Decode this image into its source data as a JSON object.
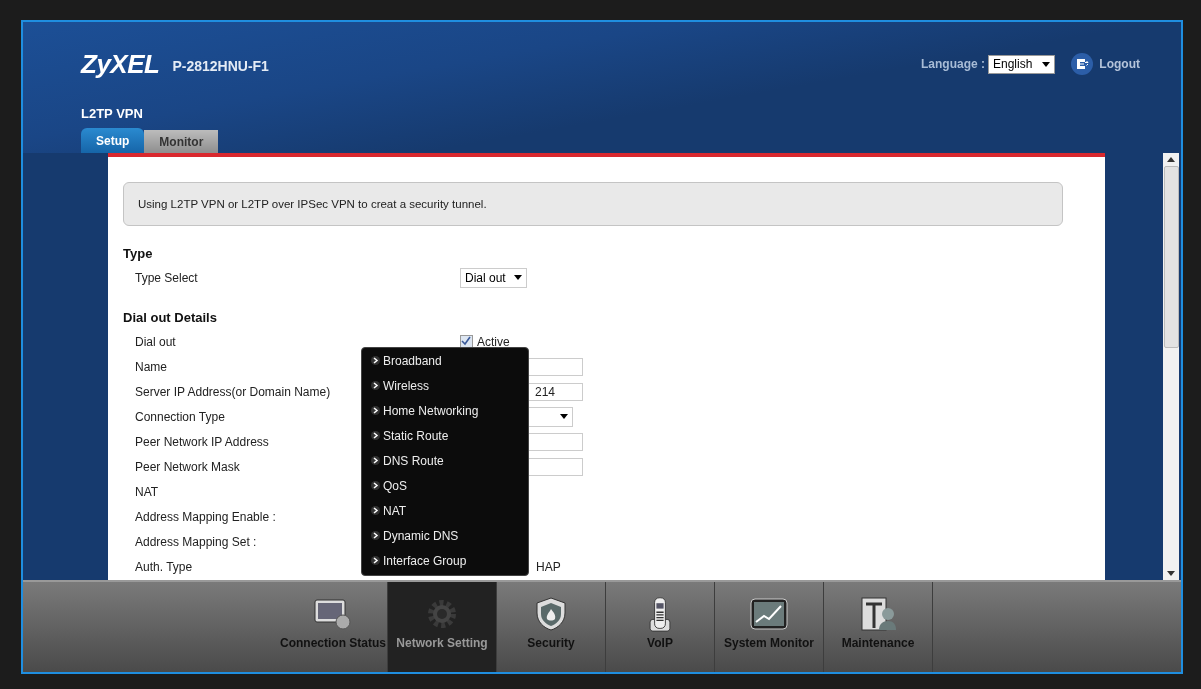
{
  "header": {
    "brand": "ZyXEL",
    "model": "P-2812HNU-F1",
    "language_label": "Language :",
    "language": "English",
    "logout": "Logout"
  },
  "page_title": "L2TP VPN",
  "tabs": [
    {
      "label": "Setup",
      "selected": true
    },
    {
      "label": "Monitor",
      "selected": false
    }
  ],
  "info": "Using L2TP VPN or L2TP over IPSec VPN to creat a security tunnel.",
  "sections": [
    {
      "title": "Type",
      "rows": [
        {
          "label": "Type Select",
          "kind": "select",
          "value": "Dial out"
        }
      ]
    },
    {
      "title": "Dial out Details",
      "rows": [
        {
          "label": "Dial out",
          "kind": "checkbox",
          "checked": true,
          "text": "Active"
        },
        {
          "label": "Name",
          "kind": "field"
        },
        {
          "label": "Server IP Address(or Domain Name)",
          "kind": "field",
          "value": "214"
        },
        {
          "label": "Connection Type",
          "kind": "select"
        },
        {
          "label": "Peer Network IP Address",
          "kind": "field"
        },
        {
          "label": "Peer Network Mask",
          "kind": "field"
        },
        {
          "label": "NAT",
          "kind": "none"
        },
        {
          "label": "Address Mapping Enable :",
          "kind": "none"
        },
        {
          "label": "Address Mapping Set :",
          "kind": "none"
        },
        {
          "label": "Auth. Type",
          "kind": "text",
          "value": "HAP"
        }
      ]
    }
  ],
  "menu": [
    "Broadband",
    "Wireless",
    "Home Networking",
    "Static Route",
    "DNS Route",
    "QoS",
    "NAT",
    "Dynamic DNS",
    "Interface Group"
  ],
  "nav": [
    {
      "label": "Connection Status",
      "selected": false
    },
    {
      "label": "Network Setting",
      "selected": true
    },
    {
      "label": "Security",
      "selected": false
    },
    {
      "label": "VoIP",
      "selected": false
    },
    {
      "label": "System Monitor",
      "selected": false
    },
    {
      "label": "Maintenance",
      "selected": false
    }
  ]
}
